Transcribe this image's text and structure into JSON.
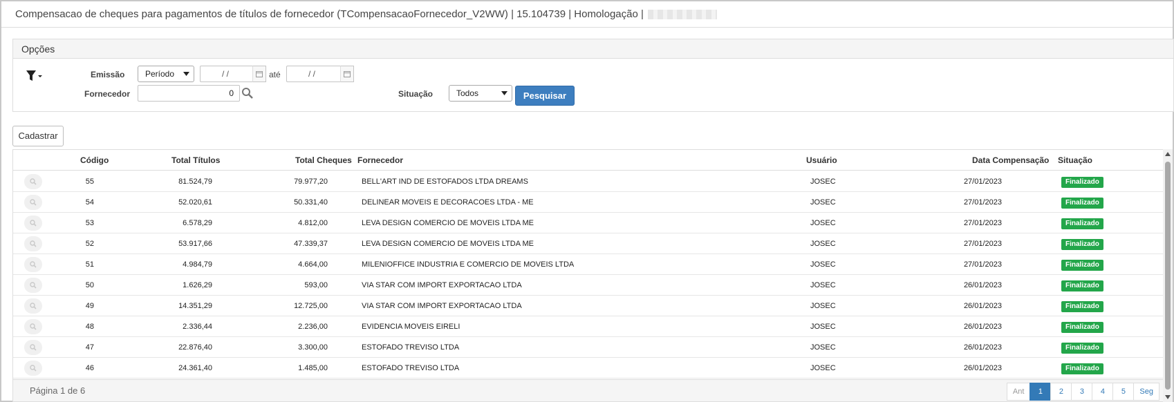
{
  "window": {
    "title": "Compensacao de cheques para pagamentos de títulos de fornecedor (TCompensacaoFornecedor_V2WW) | 15.104739 | Homologação |"
  },
  "options": {
    "header": "Opções",
    "emissao_label": "Emissão",
    "periodo_value": "Período",
    "date_from_value": "/ /",
    "ate_label": "até",
    "date_to_value": "/ /",
    "fornecedor_label": "Fornecedor",
    "fornecedor_value": "0",
    "situacao_label": "Situação",
    "situacao_value": "Todos",
    "search_button": "Pesquisar"
  },
  "actions": {
    "cadastrar": "Cadastrar"
  },
  "grid": {
    "columns": {
      "codigo": "Código",
      "total_titulos": "Total Títulos",
      "total_cheques": "Total Cheques",
      "fornecedor": "Fornecedor",
      "usuario": "Usuário",
      "data": "Data Compensação",
      "situacao": "Situação"
    },
    "rows": [
      {
        "codigo": "55",
        "total_titulos": "81.524,79",
        "total_cheques": "79.977,20",
        "fornecedor": "BELL'ART IND DE ESTOFADOS LTDA DREAMS",
        "usuario": "JOSEC",
        "data": "27/01/2023",
        "situacao": "Finalizado"
      },
      {
        "codigo": "54",
        "total_titulos": "52.020,61",
        "total_cheques": "50.331,40",
        "fornecedor": "DELINEAR MOVEIS E DECORACOES LTDA - ME",
        "usuario": "JOSEC",
        "data": "27/01/2023",
        "situacao": "Finalizado"
      },
      {
        "codigo": "53",
        "total_titulos": "6.578,29",
        "total_cheques": "4.812,00",
        "fornecedor": "LEVA DESIGN COMERCIO DE MOVEIS LTDA ME",
        "usuario": "JOSEC",
        "data": "27/01/2023",
        "situacao": "Finalizado"
      },
      {
        "codigo": "52",
        "total_titulos": "53.917,66",
        "total_cheques": "47.339,37",
        "fornecedor": "LEVA DESIGN COMERCIO DE MOVEIS LTDA ME",
        "usuario": "JOSEC",
        "data": "27/01/2023",
        "situacao": "Finalizado"
      },
      {
        "codigo": "51",
        "total_titulos": "4.984,79",
        "total_cheques": "4.664,00",
        "fornecedor": "MILENIOFFICE INDUSTRIA E COMERCIO DE MOVEIS LTDA",
        "usuario": "JOSEC",
        "data": "27/01/2023",
        "situacao": "Finalizado"
      },
      {
        "codigo": "50",
        "total_titulos": "1.626,29",
        "total_cheques": "593,00",
        "fornecedor": "VIA STAR COM IMPORT EXPORTACAO LTDA",
        "usuario": "JOSEC",
        "data": "26/01/2023",
        "situacao": "Finalizado"
      },
      {
        "codigo": "49",
        "total_titulos": "14.351,29",
        "total_cheques": "12.725,00",
        "fornecedor": "VIA STAR COM IMPORT EXPORTACAO LTDA",
        "usuario": "JOSEC",
        "data": "26/01/2023",
        "situacao": "Finalizado"
      },
      {
        "codigo": "48",
        "total_titulos": "2.336,44",
        "total_cheques": "2.236,00",
        "fornecedor": "EVIDENCIA MOVEIS EIRELI",
        "usuario": "JOSEC",
        "data": "26/01/2023",
        "situacao": "Finalizado"
      },
      {
        "codigo": "47",
        "total_titulos": "22.876,40",
        "total_cheques": "3.300,00",
        "fornecedor": "ESTOFADO TREVISO LTDA",
        "usuario": "JOSEC",
        "data": "26/01/2023",
        "situacao": "Finalizado"
      },
      {
        "codigo": "46",
        "total_titulos": "24.361,40",
        "total_cheques": "1.485,00",
        "fornecedor": "ESTOFADO TREVISO LTDA",
        "usuario": "JOSEC",
        "data": "26/01/2023",
        "situacao": "Finalizado"
      }
    ]
  },
  "pagination": {
    "info": "Página 1 de 6",
    "prev": "Ant",
    "pages": [
      "1",
      "2",
      "3",
      "4",
      "5"
    ],
    "next": "Seg",
    "active_page": "1"
  },
  "colors": {
    "primary": "#3d7ebf",
    "badge_green": "#23a64a",
    "pager_active": "#337ab7"
  }
}
